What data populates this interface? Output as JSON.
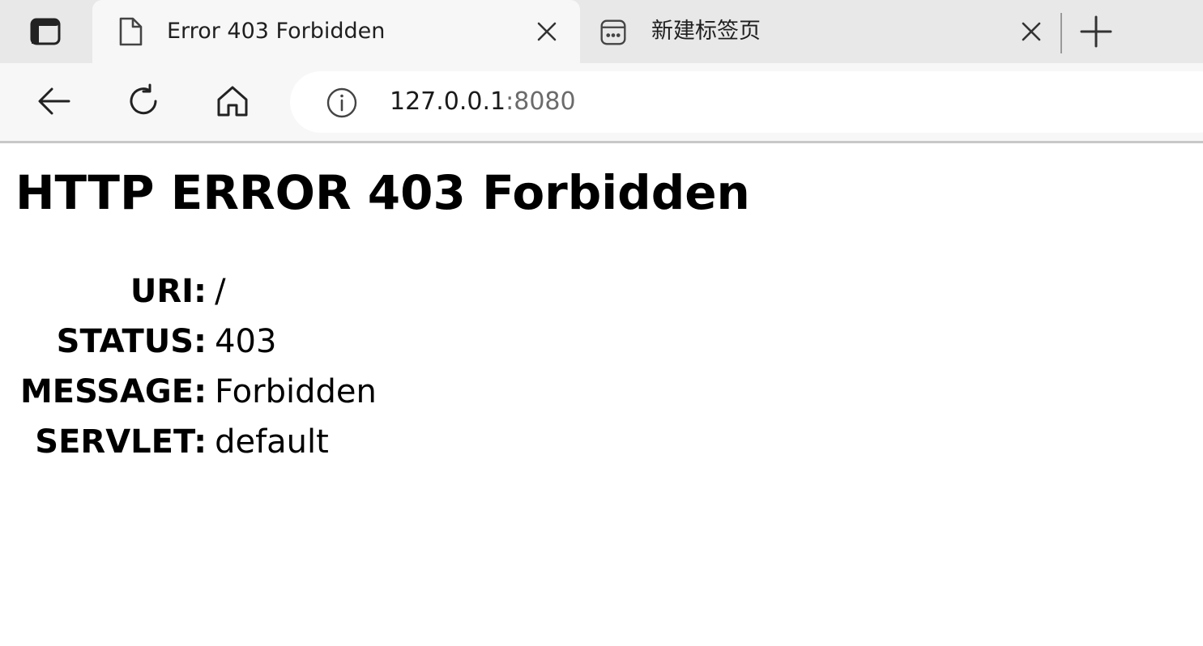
{
  "browser": {
    "tabs": [
      {
        "title": "Error 403 Forbidden",
        "icon": "page-icon",
        "active": true
      },
      {
        "title": "新建标签页",
        "icon": "new-tab-page-icon",
        "active": false
      }
    ],
    "address": {
      "host": "127.0.0.1",
      "port": ":8080"
    }
  },
  "page": {
    "heading": "HTTP ERROR 403 Forbidden",
    "rows": [
      {
        "label": "URI:",
        "value": "/"
      },
      {
        "label": "STATUS:",
        "value": "403"
      },
      {
        "label": "MESSAGE:",
        "value": "Forbidden"
      },
      {
        "label": "SERVLET:",
        "value": "default"
      }
    ]
  }
}
